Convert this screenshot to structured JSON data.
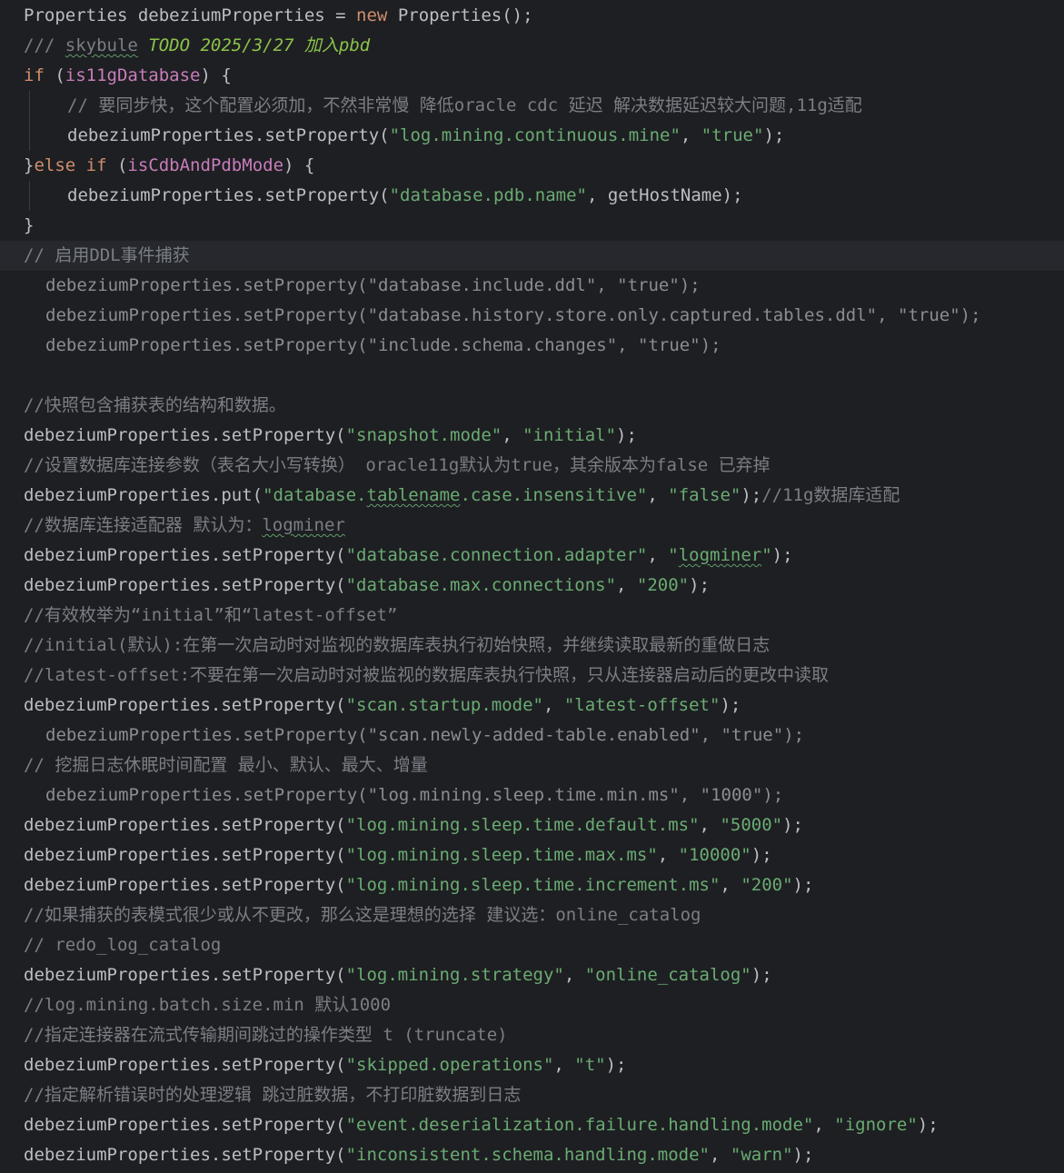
{
  "colors": {
    "background": "#1e1f22",
    "current_line": "#26282e",
    "default_text": "#bcbec4",
    "keyword": "#cf8e6d",
    "string": "#6aab73",
    "comment": "#7a7e85",
    "field": "#c77dbb",
    "todo": "#8bc34a",
    "dimmed_text": "#8a8d94"
  },
  "editor": {
    "current_line_index": 8,
    "caret_after_token": "8.1",
    "lines": [
      {
        "indent": 0,
        "guide": false,
        "dim": false,
        "tokens": [
          [
            "t",
            "Properties debeziumProperties = "
          ],
          [
            "kw",
            "new"
          ],
          [
            "t",
            " Properties();"
          ]
        ]
      },
      {
        "indent": 0,
        "guide": false,
        "dim": false,
        "tokens": [
          [
            "cm",
            "/// "
          ],
          [
            "cmtypo",
            "skybule"
          ],
          [
            "cm",
            " "
          ],
          [
            "todo",
            "TODO 2025/3/27 加入pbd"
          ]
        ]
      },
      {
        "indent": 0,
        "guide": false,
        "dim": false,
        "tokens": [
          [
            "kw",
            "if"
          ],
          [
            "t",
            " ("
          ],
          [
            "field",
            "is11gDatabase"
          ],
          [
            "t",
            ") {"
          ]
        ]
      },
      {
        "indent": 2,
        "guide": true,
        "dim": false,
        "tokens": [
          [
            "cm",
            "// 要同步快，这个配置必须加，不然非常慢 降低oracle cdc 延迟 解决数据延迟较大问题,11g适配"
          ]
        ]
      },
      {
        "indent": 2,
        "guide": true,
        "dim": false,
        "tokens": [
          [
            "t",
            "debeziumProperties.setProperty("
          ],
          [
            "str",
            "\"log.mining.continuous.mine\""
          ],
          [
            "t",
            ", "
          ],
          [
            "str",
            "\"true\""
          ],
          [
            "t",
            ");"
          ]
        ]
      },
      {
        "indent": 0,
        "guide": false,
        "dim": false,
        "tokens": [
          [
            "t",
            "}"
          ],
          [
            "kw",
            "else if"
          ],
          [
            "t",
            " ("
          ],
          [
            "field",
            "isCdbAndPdbMode"
          ],
          [
            "t",
            ") {"
          ]
        ]
      },
      {
        "indent": 2,
        "guide": true,
        "dim": false,
        "tokens": [
          [
            "t",
            "debeziumProperties.setProperty("
          ],
          [
            "str",
            "\"database.pdb.name\""
          ],
          [
            "t",
            ", getHostName);"
          ]
        ]
      },
      {
        "indent": 0,
        "guide": false,
        "dim": false,
        "tokens": [
          [
            "t",
            "}"
          ]
        ]
      },
      {
        "indent": 0,
        "guide": false,
        "dim": false,
        "tokens": [
          [
            "cm",
            "// 启用DDL事件捕获"
          ]
        ]
      },
      {
        "indent": 1,
        "guide": false,
        "dim": true,
        "tokens": [
          [
            "t",
            "debeziumProperties.setProperty("
          ],
          [
            "str",
            "\"database.include.ddl\""
          ],
          [
            "t",
            ", "
          ],
          [
            "str",
            "\"true\""
          ],
          [
            "t",
            ");"
          ]
        ]
      },
      {
        "indent": 1,
        "guide": false,
        "dim": true,
        "tokens": [
          [
            "t",
            "debeziumProperties.setProperty("
          ],
          [
            "str",
            "\"database.history.store.only.captured.tables.ddl\""
          ],
          [
            "t",
            ", "
          ],
          [
            "str",
            "\"true\""
          ],
          [
            "t",
            ");"
          ]
        ]
      },
      {
        "indent": 1,
        "guide": false,
        "dim": true,
        "tokens": [
          [
            "t",
            "debeziumProperties.setProperty("
          ],
          [
            "str",
            "\"include.schema.changes\""
          ],
          [
            "t",
            ", "
          ],
          [
            "str",
            "\"true\""
          ],
          [
            "t",
            ");"
          ]
        ]
      },
      {
        "indent": 0,
        "guide": false,
        "dim": false,
        "tokens": []
      },
      {
        "indent": 0,
        "guide": false,
        "dim": false,
        "tokens": [
          [
            "cm",
            "//快照包含捕获表的结构和数据。"
          ]
        ]
      },
      {
        "indent": 0,
        "guide": false,
        "dim": false,
        "tokens": [
          [
            "t",
            "debeziumProperties.setProperty("
          ],
          [
            "str",
            "\"snapshot.mode\""
          ],
          [
            "t",
            ", "
          ],
          [
            "str",
            "\"initial\""
          ],
          [
            "t",
            ");"
          ]
        ]
      },
      {
        "indent": 0,
        "guide": false,
        "dim": false,
        "tokens": [
          [
            "cm",
            "//设置数据库连接参数（表名大小写转换） oracle11g默认为true，其余版本为false 已弃掉"
          ]
        ]
      },
      {
        "indent": 0,
        "guide": false,
        "dim": false,
        "tokens": [
          [
            "t",
            "debeziumProperties.put("
          ],
          [
            "str",
            "\"database."
          ],
          [
            "strtypo",
            "tablename"
          ],
          [
            "str",
            ".case.insensitive\""
          ],
          [
            "t",
            ", "
          ],
          [
            "str",
            "\"false\""
          ],
          [
            "t",
            ");"
          ],
          [
            "cm",
            "//11g数据库适配"
          ]
        ]
      },
      {
        "indent": 0,
        "guide": false,
        "dim": false,
        "tokens": [
          [
            "cm",
            "//数据库连接适配器 默认为："
          ],
          [
            "cmtypo",
            "logminer"
          ]
        ]
      },
      {
        "indent": 0,
        "guide": false,
        "dim": false,
        "tokens": [
          [
            "t",
            "debeziumProperties.setProperty("
          ],
          [
            "str",
            "\"database.connection.adapter\""
          ],
          [
            "t",
            ", "
          ],
          [
            "str",
            "\""
          ],
          [
            "strtypo",
            "logminer"
          ],
          [
            "str",
            "\""
          ],
          [
            "t",
            ");"
          ]
        ]
      },
      {
        "indent": 0,
        "guide": false,
        "dim": false,
        "tokens": [
          [
            "t",
            "debeziumProperties.setProperty("
          ],
          [
            "str",
            "\"database.max.connections\""
          ],
          [
            "t",
            ", "
          ],
          [
            "str",
            "\"200\""
          ],
          [
            "t",
            ");"
          ]
        ]
      },
      {
        "indent": 0,
        "guide": false,
        "dim": false,
        "tokens": [
          [
            "cm",
            "//有效枚举为“initial”和“latest-offset”"
          ]
        ]
      },
      {
        "indent": 0,
        "guide": false,
        "dim": false,
        "tokens": [
          [
            "cm",
            "//initial(默认):在第一次启动时对监视的数据库表执行初始快照，并继续读取最新的重做日志"
          ]
        ]
      },
      {
        "indent": 0,
        "guide": false,
        "dim": false,
        "tokens": [
          [
            "cm",
            "//latest-offset:不要在第一次启动时对被监视的数据库表执行快照，只从连接器启动后的更改中读取"
          ]
        ]
      },
      {
        "indent": 0,
        "guide": false,
        "dim": false,
        "tokens": [
          [
            "t",
            "debeziumProperties.setProperty("
          ],
          [
            "str",
            "\"scan.startup.mode\""
          ],
          [
            "t",
            ", "
          ],
          [
            "str",
            "\"latest-offset\""
          ],
          [
            "t",
            ");"
          ]
        ]
      },
      {
        "indent": 1,
        "guide": false,
        "dim": true,
        "tokens": [
          [
            "t",
            "debeziumProperties.setProperty("
          ],
          [
            "str",
            "\"scan.newly-added-table.enabled\""
          ],
          [
            "t",
            ", "
          ],
          [
            "str",
            "\"true\""
          ],
          [
            "t",
            ");"
          ]
        ]
      },
      {
        "indent": 0,
        "guide": false,
        "dim": false,
        "tokens": [
          [
            "cm",
            "// 挖掘日志休眠时间配置 最小、默认、最大、增量"
          ]
        ]
      },
      {
        "indent": 1,
        "guide": false,
        "dim": true,
        "tokens": [
          [
            "t",
            "debeziumProperties.setProperty("
          ],
          [
            "str",
            "\"log.mining.sleep.time.min.ms\""
          ],
          [
            "t",
            ", "
          ],
          [
            "str",
            "\"1000\""
          ],
          [
            "t",
            ");"
          ]
        ]
      },
      {
        "indent": 0,
        "guide": false,
        "dim": false,
        "tokens": [
          [
            "t",
            "debeziumProperties.setProperty("
          ],
          [
            "str",
            "\"log.mining.sleep.time.default.ms\""
          ],
          [
            "t",
            ", "
          ],
          [
            "str",
            "\"5000\""
          ],
          [
            "t",
            ");"
          ]
        ]
      },
      {
        "indent": 0,
        "guide": false,
        "dim": false,
        "tokens": [
          [
            "t",
            "debeziumProperties.setProperty("
          ],
          [
            "str",
            "\"log.mining.sleep.time.max.ms\""
          ],
          [
            "t",
            ", "
          ],
          [
            "str",
            "\"10000\""
          ],
          [
            "t",
            ");"
          ]
        ]
      },
      {
        "indent": 0,
        "guide": false,
        "dim": false,
        "tokens": [
          [
            "t",
            "debeziumProperties.setProperty("
          ],
          [
            "str",
            "\"log.mining.sleep.time.increment.ms\""
          ],
          [
            "t",
            ", "
          ],
          [
            "str",
            "\"200\""
          ],
          [
            "t",
            ");"
          ]
        ]
      },
      {
        "indent": 0,
        "guide": false,
        "dim": false,
        "tokens": [
          [
            "cm",
            "//如果捕获的表模式很少或从不更改，那么这是理想的选择 建议选：online_catalog"
          ]
        ]
      },
      {
        "indent": 0,
        "guide": false,
        "dim": false,
        "tokens": [
          [
            "cm",
            "// redo_log_catalog"
          ]
        ]
      },
      {
        "indent": 0,
        "guide": false,
        "dim": false,
        "tokens": [
          [
            "t",
            "debeziumProperties.setProperty("
          ],
          [
            "str",
            "\"log.mining.strategy\""
          ],
          [
            "t",
            ", "
          ],
          [
            "str",
            "\"online_catalog\""
          ],
          [
            "t",
            ");"
          ]
        ]
      },
      {
        "indent": 0,
        "guide": false,
        "dim": false,
        "tokens": [
          [
            "cm",
            "//log.mining.batch.size.min 默认1000"
          ]
        ]
      },
      {
        "indent": 0,
        "guide": false,
        "dim": false,
        "tokens": [
          [
            "cm",
            "//指定连接器在流式传输期间跳过的操作类型 t (truncate)"
          ]
        ]
      },
      {
        "indent": 0,
        "guide": false,
        "dim": false,
        "tokens": [
          [
            "t",
            "debeziumProperties.setProperty("
          ],
          [
            "str",
            "\"skipped.operations\""
          ],
          [
            "t",
            ", "
          ],
          [
            "str",
            "\"t\""
          ],
          [
            "t",
            ");"
          ]
        ]
      },
      {
        "indent": 0,
        "guide": false,
        "dim": false,
        "tokens": [
          [
            "cm",
            "//指定解析错误时的处理逻辑 跳过脏数据，不打印脏数据到日志"
          ]
        ]
      },
      {
        "indent": 0,
        "guide": false,
        "dim": false,
        "tokens": [
          [
            "t",
            "debeziumProperties.setProperty("
          ],
          [
            "str",
            "\"event.deserialization.failure.handling.mode\""
          ],
          [
            "t",
            ", "
          ],
          [
            "str",
            "\"ignore\""
          ],
          [
            "t",
            ");"
          ]
        ]
      },
      {
        "indent": 0,
        "guide": false,
        "dim": false,
        "tokens": [
          [
            "t",
            "debeziumProperties.setProperty("
          ],
          [
            "str",
            "\"inconsistent.schema.handling.mode\""
          ],
          [
            "t",
            ", "
          ],
          [
            "str",
            "\"warn\""
          ],
          [
            "t",
            ");"
          ]
        ]
      }
    ]
  }
}
